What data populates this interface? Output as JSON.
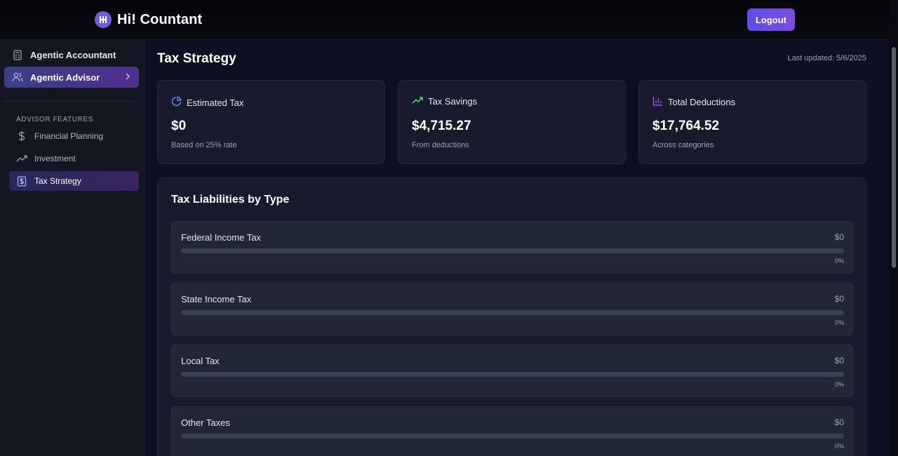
{
  "header": {
    "app_name": "Hi! Countant",
    "logout_label": "Logout"
  },
  "sidebar": {
    "items": [
      {
        "label": "Agentic Accountant",
        "icon": "calculator-icon"
      },
      {
        "label": "Agentic Advisor",
        "icon": "users-icon",
        "active": true
      }
    ],
    "section_label": "ADVISOR FEATURES",
    "sub_items": [
      {
        "label": "Financial Planning",
        "icon": "dollar-icon"
      },
      {
        "label": "Investment",
        "icon": "trending-up-icon"
      },
      {
        "label": "Tax Strategy",
        "icon": "receipt-dollar-icon",
        "active": true
      }
    ]
  },
  "main": {
    "title": "Tax Strategy",
    "last_updated": "Last updated: 5/6/2025",
    "cards": [
      {
        "title": "Estimated Tax",
        "value": "$0",
        "sub": "Based on 25% rate",
        "icon": "pie-chart-icon",
        "icon_color": "#6b8cff"
      },
      {
        "title": "Tax Savings",
        "value": "$4,715.27",
        "sub": "From deductions",
        "icon": "trending-up-icon",
        "icon_color": "#4ade80"
      },
      {
        "title": "Total Deductions",
        "value": "$17,764.52",
        "sub": "Across categories",
        "icon": "bar-chart-icon",
        "icon_color": "#a855f7"
      }
    ],
    "liabilities": {
      "title": "Tax Liabilities by Type",
      "rows": [
        {
          "name": "Federal Income Tax",
          "amount": "$0",
          "percent": "0%",
          "fraction": 0
        },
        {
          "name": "State Income Tax",
          "amount": "$0",
          "percent": "0%",
          "fraction": 0
        },
        {
          "name": "Local Tax",
          "amount": "$0",
          "percent": "0%",
          "fraction": 0
        },
        {
          "name": "Other Taxes",
          "amount": "$0",
          "percent": "0%",
          "fraction": 0
        }
      ]
    }
  },
  "colors": {
    "accent": "#6d5ce0",
    "background": "#0d1020",
    "card": "#171b2b"
  }
}
